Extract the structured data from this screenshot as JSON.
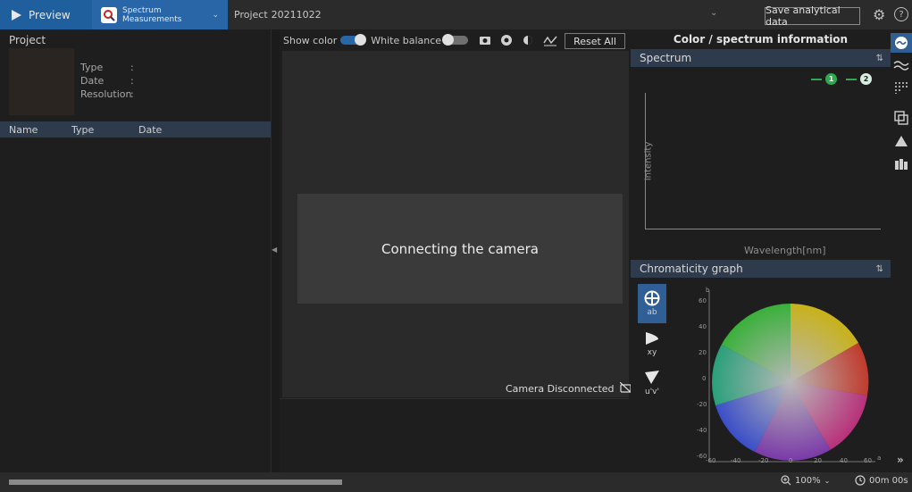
{
  "topbar": {
    "preview_label": "Preview",
    "mode_label_line1": "Spectrum",
    "mode_label_line2": "Measurements",
    "project_label": "Project",
    "project_name": "20211022",
    "save_label": "Save analytical data"
  },
  "left": {
    "title": "Project",
    "meta": [
      {
        "label": "Type",
        "colon": ":"
      },
      {
        "label": "Date",
        "colon": ":"
      },
      {
        "label": "Resolution",
        "colon": ":"
      }
    ],
    "columns": [
      "Name",
      "Type",
      "Date"
    ]
  },
  "center": {
    "show_color_label": "Show color",
    "white_balance_label": "White balance",
    "show_color_on": true,
    "white_balance_on": false,
    "reset_label": "Reset All",
    "overlay_text": "Connecting the camera",
    "camera_status": "Camera Disconnected"
  },
  "right": {
    "title": "Color / spectrum information",
    "spectrum": {
      "heading": "Spectrum",
      "ylabel": "Intensity",
      "xlabel": "Wavelength[nm]",
      "legend": [
        {
          "label": "1",
          "color": "#2fa84f"
        },
        {
          "label": "2",
          "color": "#2fa84f"
        }
      ]
    },
    "chroma": {
      "heading": "Chromaticity graph",
      "modes": [
        {
          "label": "ab"
        },
        {
          "label": "xy"
        },
        {
          "label": "u'v'"
        }
      ],
      "b_label": "b",
      "a_label": "a",
      "y_ticks": [
        "60",
        "40",
        "20",
        "0",
        "-20",
        "-40",
        "-60"
      ],
      "x_ticks": [
        "-60",
        "-40",
        "-20",
        "0",
        "20",
        "40",
        "60"
      ]
    }
  },
  "statusbar": {
    "zoom": "100%",
    "time": "00m 00s"
  },
  "colors": {
    "accent": "#2966a8",
    "panel_head": "#2e3b4c"
  }
}
